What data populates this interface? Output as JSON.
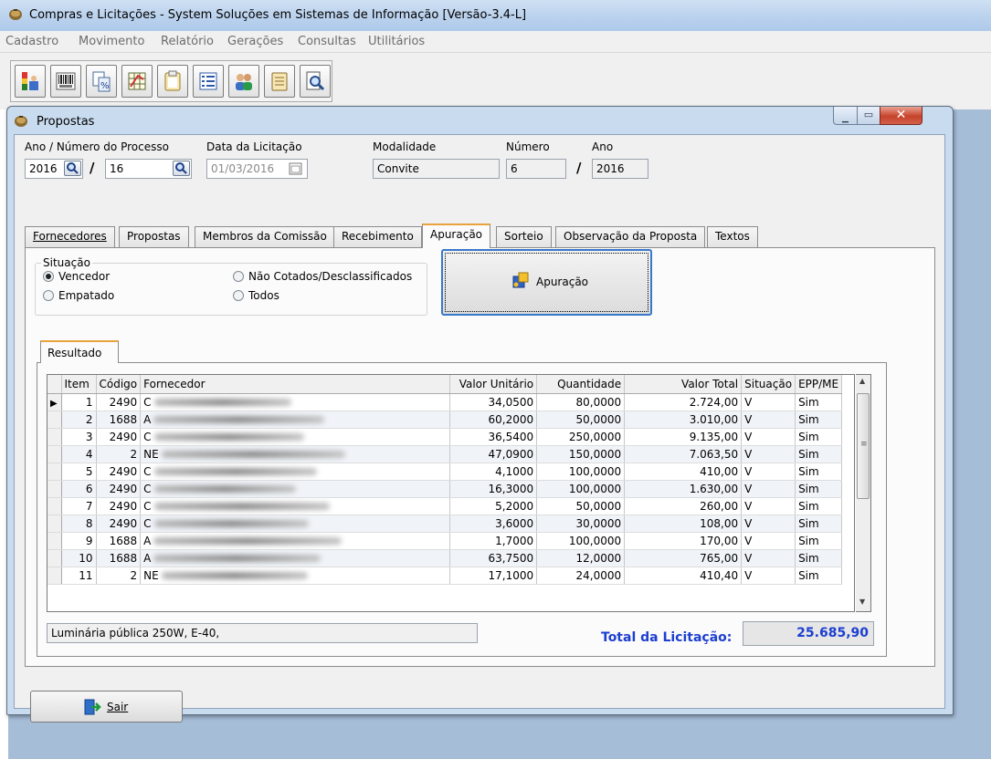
{
  "app": {
    "title": "Compras e Licitações - System Soluções em Sistemas de Informação [Versão-3.4-L]"
  },
  "menu": [
    "Cadastro",
    "Movimento",
    "Relatório",
    "Gerações",
    "Consultas",
    "Utilitários"
  ],
  "toolbar_icons": [
    "report-chart-icon",
    "barcode-icon",
    "percent-document-icon",
    "spreadsheet-icon",
    "clipboard-icon",
    "list-icon",
    "users-icon",
    "notepad-icon",
    "search-document-icon"
  ],
  "window": {
    "title": "Propostas"
  },
  "header": {
    "ano_numero_label": "Ano / Número do Processo",
    "ano": "2016",
    "numero": "16",
    "data_label": "Data da Licitação",
    "data": "01/03/2016",
    "modalidade_label": "Modalidade",
    "modalidade": "Convite",
    "numero_label": "Número",
    "numero_mod": "6",
    "ano_label": "Ano",
    "ano_mod": "2016"
  },
  "tabs": [
    "Fornecedores",
    "Propostas",
    "Membros da Comissão",
    "Recebimento",
    "Apuração",
    "Sorteio",
    "Observação da Proposta",
    "Textos"
  ],
  "situacao": {
    "label": "Situação",
    "options": [
      "Vencedor",
      "Empatado",
      "Não Cotados/Desclassificados",
      "Todos"
    ],
    "selected": "Vencedor"
  },
  "apuracao_button": "Apuração",
  "resultado_tab": "Resultado",
  "grid": {
    "columns": [
      "Item",
      "Código",
      "Fornecedor",
      "Valor Unitário",
      "Quantidade",
      "Valor Total",
      "Situação",
      "EPP/ME"
    ],
    "rows": [
      [
        "1",
        "2490",
        "C",
        "34,0500",
        "80,0000",
        "2.724,00",
        "V",
        "Sim"
      ],
      [
        "2",
        "1688",
        "A",
        "60,2000",
        "50,0000",
        "3.010,00",
        "V",
        "Sim"
      ],
      [
        "3",
        "2490",
        "C",
        "36,5400",
        "250,0000",
        "9.135,00",
        "V",
        "Sim"
      ],
      [
        "4",
        "2",
        "NE",
        "47,0900",
        "150,0000",
        "7.063,50",
        "V",
        "Sim"
      ],
      [
        "5",
        "2490",
        "C",
        "4,1000",
        "100,0000",
        "410,00",
        "V",
        "Sim"
      ],
      [
        "6",
        "2490",
        "C",
        "16,3000",
        "100,0000",
        "1.630,00",
        "V",
        "Sim"
      ],
      [
        "7",
        "2490",
        "C",
        "5,2000",
        "50,0000",
        "260,00",
        "V",
        "Sim"
      ],
      [
        "8",
        "2490",
        "C",
        "3,6000",
        "30,0000",
        "108,00",
        "V",
        "Sim"
      ],
      [
        "9",
        "1688",
        "A",
        "1,7000",
        "100,0000",
        "170,00",
        "V",
        "Sim"
      ],
      [
        "10",
        "1688",
        "A",
        "63,7500",
        "12,0000",
        "765,00",
        "V",
        "Sim"
      ],
      [
        "11",
        "2",
        "NE",
        "17,1000",
        "24,0000",
        "410,40",
        "V",
        "Sim"
      ]
    ]
  },
  "descricao": "Luminária pública 250W, E-40,",
  "total_label": "Total da Licitação:",
  "total_value": "25.685,90",
  "sair_button": "Sair"
}
